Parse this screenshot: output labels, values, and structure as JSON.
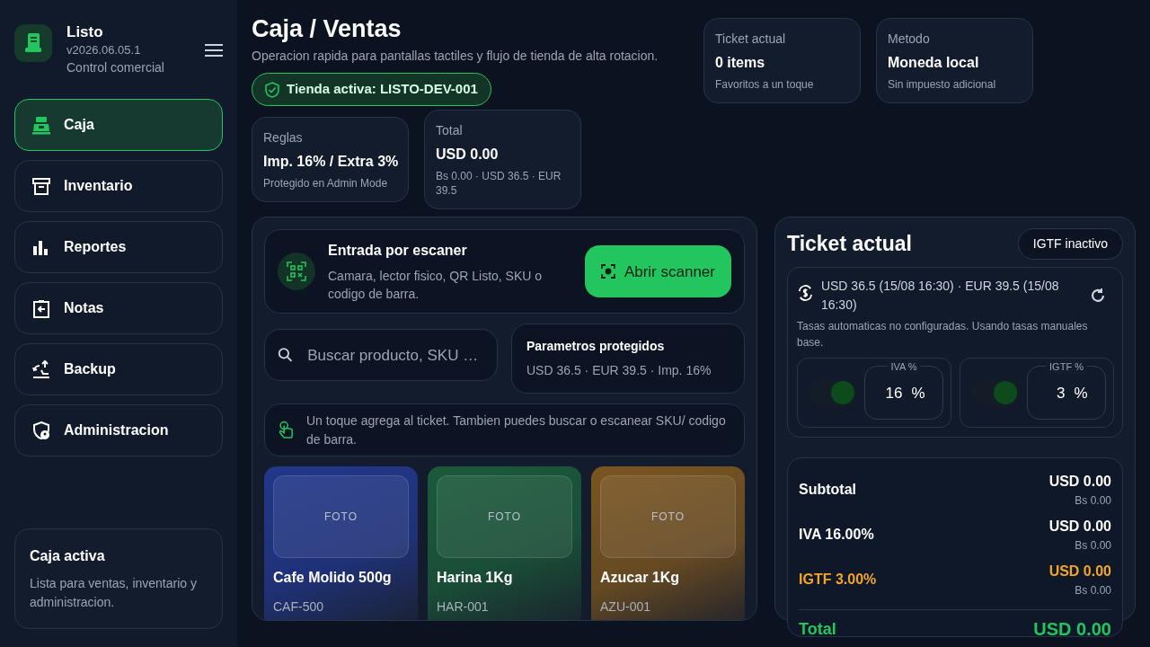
{
  "app": {
    "name": "Listo",
    "version": "v2026.06.05.1",
    "subtitle": "Control comercial"
  },
  "sidebar": {
    "items": [
      {
        "label": "Caja",
        "kind": "register",
        "selected": true
      },
      {
        "label": "Inventario",
        "kind": "archive",
        "selected": false
      },
      {
        "label": "Reportes",
        "kind": "bars",
        "selected": false
      },
      {
        "label": "Notas",
        "kind": "clipboard",
        "selected": false
      },
      {
        "label": "Backup",
        "kind": "backup",
        "selected": false
      },
      {
        "label": "Administracion",
        "kind": "admin",
        "selected": false
      }
    ],
    "status_card": {
      "title": "Caja activa",
      "text": "Lista para ventas, inventario y administracion."
    }
  },
  "header": {
    "title": "Caja / Ventas",
    "subtitle": "Operacion rapida para pantallas tactiles y flujo de tienda de alta rotacion.",
    "store_badge": "Tienda activa: LISTO-DEV-001"
  },
  "stat_cards": [
    {
      "label": "Ticket actual",
      "value": "0 items",
      "note": "Favoritos a un toque"
    },
    {
      "label": "Metodo",
      "value": "Moneda local",
      "note": "Sin impuesto adicional"
    },
    {
      "label": "Reglas",
      "value": "Imp. 16% / Extra 3%",
      "note": "Protegido en Admin Mode"
    },
    {
      "label": "Total",
      "value": "USD 0.00",
      "note": "Bs 0.00 · USD 36.5 · EUR 39.5"
    }
  ],
  "scanner": {
    "title": "Entrada por escaner",
    "text": "Camara, lector fisico, QR Listo, SKU o codigo de barra.",
    "button": "Abrir scanner"
  },
  "search": {
    "placeholder": "Buscar producto, SKU …"
  },
  "params": {
    "title": "Parametros protegidos",
    "text": "USD 36.5 · EUR 39.5 · Imp. 16%"
  },
  "hint": {
    "text": "Un toque agrega al ticket. Tambien puedes buscar o escanear SKU/ codigo de barra."
  },
  "products": [
    {
      "name": "Cafe Molido 500g",
      "sku": "CAF-500",
      "photo_label": "FOTO",
      "color": "#22378a"
    },
    {
      "name": "Harina 1Kg",
      "sku": "HAR-001",
      "photo_label": "FOTO",
      "color": "#1b5a3a"
    },
    {
      "name": "Azucar 1Kg",
      "sku": "AZU-001",
      "photo_label": "FOTO",
      "color": "#7a5520"
    }
  ],
  "ticket": {
    "title": "Ticket actual",
    "igtf_badge": "IGTF inactivo",
    "rates": {
      "text": "USD 36.5 (15/08 16:30) · EUR 39.5 (15/08 16:30)",
      "note": "Tasas automaticas no configuradas. Usando tasas manuales base."
    },
    "taxes": [
      {
        "label": "IVA %",
        "value": "16",
        "unit": "%",
        "on": true
      },
      {
        "label": "IGTF %",
        "value": "3",
        "unit": "%",
        "on": true
      }
    ],
    "totals": [
      {
        "label": "Subtotal",
        "usd": "USD 0.00",
        "bs": "Bs 0.00",
        "kind": "plain"
      },
      {
        "label": "IVA 16.00%",
        "usd": "USD 0.00",
        "bs": "Bs 0.00",
        "kind": "plain"
      },
      {
        "label": "IGTF 3.00%",
        "usd": "USD 0.00",
        "bs": "Bs 0.00",
        "kind": "surcharge"
      }
    ],
    "total": {
      "label": "Total",
      "usd": "USD 0.00"
    }
  }
}
